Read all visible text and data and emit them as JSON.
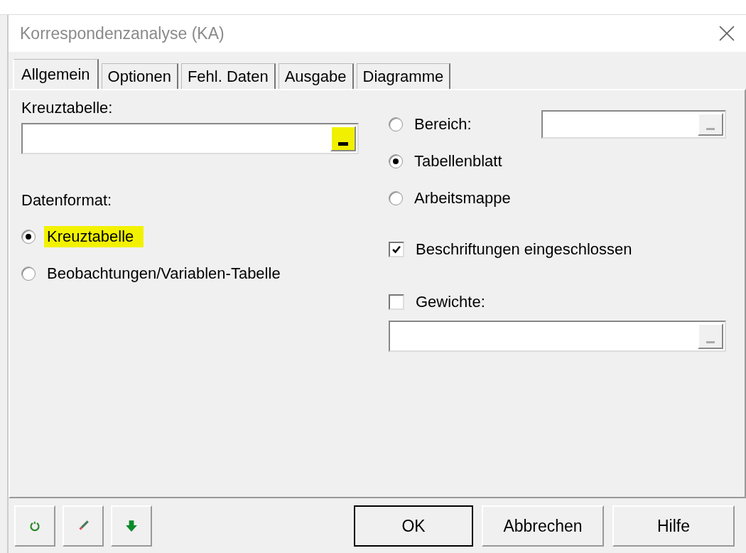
{
  "window": {
    "title": "Korrespondenzanalyse (KA)"
  },
  "tabs": [
    {
      "label": "Allgemein",
      "selected": true
    },
    {
      "label": "Optionen",
      "selected": false
    },
    {
      "label": "Fehl. Daten",
      "selected": false
    },
    {
      "label": "Ausgabe",
      "selected": false
    },
    {
      "label": "Diagramme",
      "selected": false
    }
  ],
  "crosstab": {
    "label": "Kreuztabelle:",
    "button_highlighted": true
  },
  "data_format": {
    "label": "Datenformat:",
    "options": [
      {
        "label": "Kreuztabelle",
        "selected": true,
        "highlighted": true
      },
      {
        "label": "Beobachtungen/Variablen-Tabelle",
        "selected": false,
        "highlighted": false
      }
    ]
  },
  "range_options": [
    {
      "label": "Bereich:",
      "selected": false
    },
    {
      "label": "Tabellenblatt",
      "selected": true
    },
    {
      "label": "Arbeitsmappe",
      "selected": false
    }
  ],
  "labels_included": {
    "label": "Beschriftungen eingeschlossen",
    "checked": true
  },
  "weights": {
    "label": "Gewichte:",
    "checked": false
  },
  "buttons": [
    {
      "label": "OK",
      "default": true
    },
    {
      "label": "Abbrechen",
      "default": false
    },
    {
      "label": "Hilfe",
      "default": false
    }
  ]
}
